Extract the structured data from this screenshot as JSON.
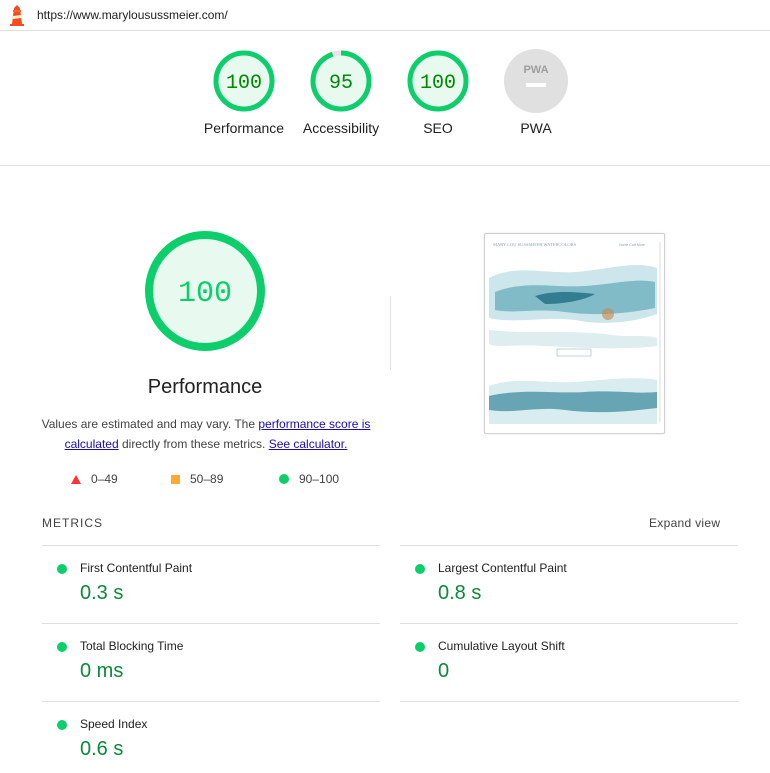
{
  "header": {
    "url": "https://www.marylousussmeier.com/"
  },
  "summary": {
    "gauges": [
      {
        "label": "Performance",
        "score": "100",
        "value": 100
      },
      {
        "label": "Accessibility",
        "score": "95",
        "value": 95
      },
      {
        "label": "SEO",
        "score": "100",
        "value": 100
      },
      {
        "label": "PWA",
        "badge": "PWA"
      }
    ]
  },
  "performance": {
    "score": "100",
    "title": "Performance",
    "desc_prefix": "Values are estimated and may vary. The ",
    "desc_link1": "performance score is calculated",
    "desc_middle": " directly from these metrics. ",
    "desc_link2": "See calculator."
  },
  "legend": {
    "fail": "0–49",
    "average": "50–89",
    "pass": "90–100"
  },
  "screenshot": {
    "site_title": "MARY LOU SUSSMEIER WATERCOLORS",
    "nav": "Home   Cart   More"
  },
  "metrics": {
    "heading": "METRICS",
    "expand_label": "Expand view",
    "items": [
      {
        "label": "First Contentful Paint",
        "value": "0.3 s"
      },
      {
        "label": "Largest Contentful Paint",
        "value": "0.8 s"
      },
      {
        "label": "Total Blocking Time",
        "value": "0 ms"
      },
      {
        "label": "Cumulative Layout Shift",
        "value": "0"
      },
      {
        "label": "Speed Index",
        "value": "0.6 s"
      }
    ]
  },
  "colors": {
    "pass": "#0cce6b",
    "pass_text": "#008800",
    "average": "#ffaa33",
    "fail": "#ff3333"
  }
}
